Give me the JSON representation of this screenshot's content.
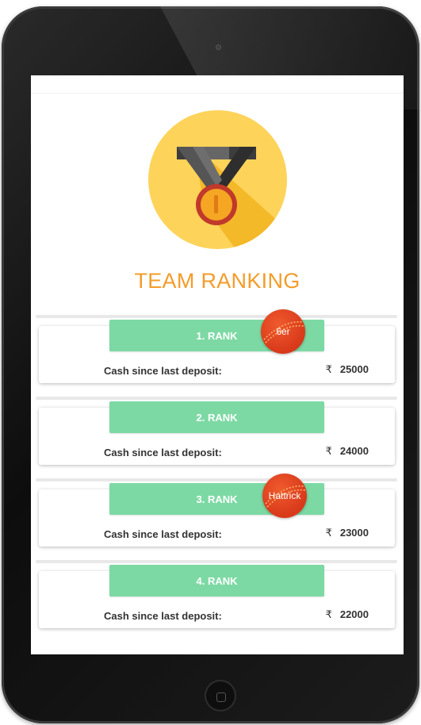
{
  "page": {
    "title": "TEAM RANKING"
  },
  "colors": {
    "accent": "#f39c2a",
    "rank_bar": "#7dd9a4",
    "badge": "#e04422",
    "medal_bg": "#fdd35a"
  },
  "icons": {
    "medal": "medal-icon",
    "rupee": "rupee-icon",
    "badge": "cricket-ball-badge"
  },
  "rankings": [
    {
      "rank_label": "1. RANK",
      "cash_label": "Cash since last deposit:",
      "currency_symbol": "₹",
      "amount": "25000",
      "badge": "6er"
    },
    {
      "rank_label": "2. RANK",
      "cash_label": "Cash since last deposit:",
      "currency_symbol": "₹",
      "amount": "24000",
      "badge": ""
    },
    {
      "rank_label": "3. RANK",
      "cash_label": "Cash since last deposit:",
      "currency_symbol": "₹",
      "amount": "23000",
      "badge": "Hattrick"
    },
    {
      "rank_label": "4. RANK",
      "cash_label": "Cash since last deposit:",
      "currency_symbol": "₹",
      "amount": "22000",
      "badge": ""
    }
  ]
}
